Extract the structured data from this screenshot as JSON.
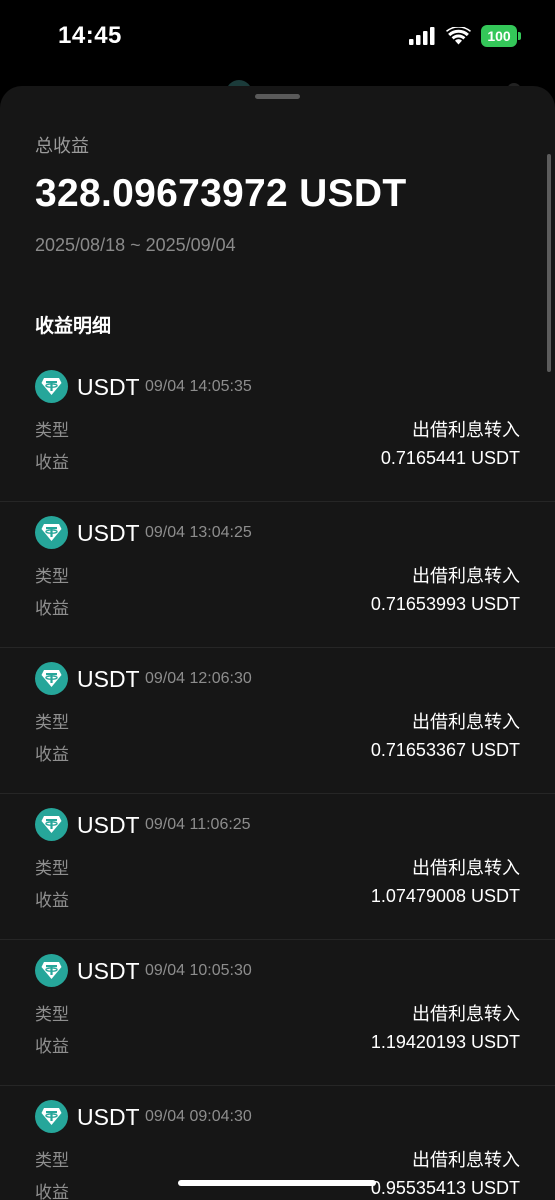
{
  "status_bar": {
    "time": "14:45",
    "battery": "100",
    "battery_color": "#34c759"
  },
  "summary": {
    "label": "总收益",
    "amount": "328.09673972 USDT",
    "date_range": "2025/08/18 ~ 2025/09/04"
  },
  "section": {
    "title": "收益明细"
  },
  "records": [
    {
      "coin": "USDT",
      "time": "09/04 14:05:35",
      "type_label": "类型",
      "type_value": "出借利息转入",
      "income_label": "收益",
      "income_value": "0.7165441 USDT"
    },
    {
      "coin": "USDT",
      "time": "09/04 13:04:25",
      "type_label": "类型",
      "type_value": "出借利息转入",
      "income_label": "收益",
      "income_value": "0.71653993 USDT"
    },
    {
      "coin": "USDT",
      "time": "09/04 12:06:30",
      "type_label": "类型",
      "type_value": "出借利息转入",
      "income_label": "收益",
      "income_value": "0.71653367 USDT"
    },
    {
      "coin": "USDT",
      "time": "09/04 11:06:25",
      "type_label": "类型",
      "type_value": "出借利息转入",
      "income_label": "收益",
      "income_value": "1.07479008 USDT"
    },
    {
      "coin": "USDT",
      "time": "09/04 10:05:30",
      "type_label": "类型",
      "type_value": "出借利息转入",
      "income_label": "收益",
      "income_value": "1.19420193 USDT"
    },
    {
      "coin": "USDT",
      "time": "09/04 09:04:30",
      "type_label": "类型",
      "type_value": "出借利息转入",
      "income_label": "收益",
      "income_value": "0.95535413 USDT"
    }
  ],
  "icons": {
    "coin": "tether-icon",
    "signal": "cellular-signal-icon",
    "wifi": "wifi-icon",
    "battery": "battery-icon"
  },
  "colors": {
    "tether": "#26a69a",
    "sheet_bg": "#161616"
  }
}
